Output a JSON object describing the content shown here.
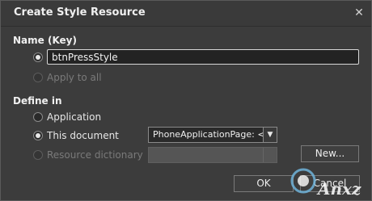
{
  "dialog": {
    "title": "Create Style Resource",
    "close_glyph": "✕"
  },
  "name_section": {
    "label": "Name (Key)",
    "key_value": "btnPressStyle",
    "apply_to_all_label": "Apply to all"
  },
  "define_in": {
    "label": "Define in",
    "application_label": "Application",
    "this_document_label": "This document",
    "this_document_select_value": "PhoneApplicationPage: <r",
    "resource_dictionary_label": "Resource dictionary",
    "new_button_label": "New..."
  },
  "footer": {
    "ok_label": "OK",
    "cancel_label": "Cancel"
  },
  "watermark": {
    "text": "Anxz"
  },
  "icons": [
    "close-icon",
    "chevron-down-icon"
  ]
}
